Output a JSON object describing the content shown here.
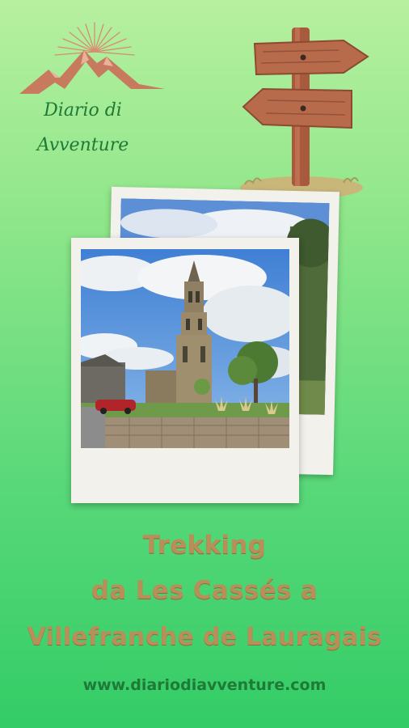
{
  "logo": {
    "line1": "Diario di",
    "line2": "Avventure"
  },
  "title": {
    "line1": "Trekking",
    "line2": "da Les Cassés a",
    "line3": "Villefranche de Lauragais"
  },
  "website": "www.diariodiavventure.com",
  "colors": {
    "background_top": "#b7f0a0",
    "background_bottom": "#33cc66",
    "title": "#b98e58",
    "brand_green": "#1e7a36",
    "signpost": "#b86b4a",
    "polaroid_frame": "#f2f1ec"
  }
}
